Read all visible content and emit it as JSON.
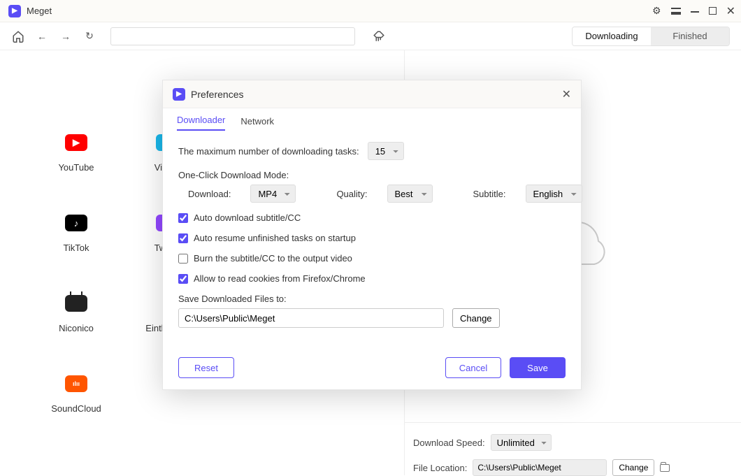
{
  "app_title": "Meget",
  "segmented": {
    "downloading": "Downloading",
    "finished": "Finished"
  },
  "tiles": {
    "youtube": "YouTube",
    "vimeo": "Vimeo",
    "tiktok": "TikTok",
    "twitch": "Twitch",
    "niconico": "Niconico",
    "einthusan": "Einthusa...",
    "soundcloud": "SoundCloud"
  },
  "bottom": {
    "speed_label": "Download Speed:",
    "speed_value": "Unlimited",
    "location_label": "File Location:",
    "location_value": "C:\\Users\\Public\\Meget",
    "change": "Change"
  },
  "modal": {
    "title": "Preferences",
    "tab_downloader": "Downloader",
    "tab_network": "Network",
    "max_tasks_label": "The maximum number of downloading tasks:",
    "max_tasks_value": "15",
    "one_click_label": "One-Click Download Mode:",
    "download_label": "Download:",
    "download_value": "MP4",
    "quality_label": "Quality:",
    "quality_value": "Best",
    "subtitle_label": "Subtitle:",
    "subtitle_value": "English",
    "chk1": "Auto download subtitle/CC",
    "chk2": "Auto resume unfinished tasks on startup",
    "chk3": "Burn the subtitle/CC to the output video",
    "chk4": "Allow to read cookies from Firefox/Chrome",
    "save_to_label": "Save Downloaded Files to:",
    "save_to_value": "C:\\Users\\Public\\Meget",
    "change": "Change",
    "reset": "Reset",
    "cancel": "Cancel",
    "save": "Save"
  }
}
